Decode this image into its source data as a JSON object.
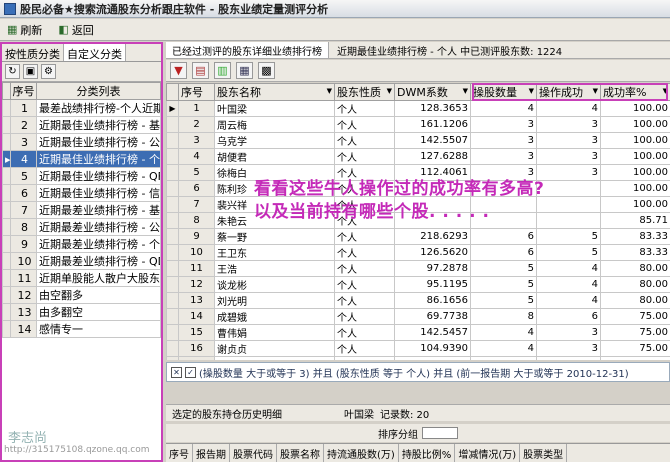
{
  "window": {
    "title": "股民必备★搜索流通股东分析跟庄软件  -  股东业绩定量测评分析"
  },
  "toolbar": {
    "refresh": "刷新",
    "back": "返回"
  },
  "left": {
    "tabs": [
      "按性质分类",
      "自定义分类"
    ],
    "headers": [
      "序号",
      "分类列表"
    ],
    "rows": [
      [
        "1",
        "最差战绩排行榜-个人近期"
      ],
      [
        "2",
        "近期最佳业绩排行榜 - 基金"
      ],
      [
        "3",
        "近期最佳业绩排行榜 - 公司"
      ],
      [
        "4",
        "近期最佳业绩排行榜 - 个人"
      ],
      [
        "5",
        "近期最佳业绩排行榜 - QFII"
      ],
      [
        "6",
        "近期最佳业绩排行榜 - 信"
      ],
      [
        "7",
        "近期最差业绩排行榜 - 基金"
      ],
      [
        "8",
        "近期最差业绩排行榜 - 公司"
      ],
      [
        "9",
        "近期最差业绩排行榜 - 个人"
      ],
      [
        "10",
        "近期最差业绩排行榜 - QDII"
      ],
      [
        "11",
        "近期单股能人散户大股东排"
      ],
      [
        "12",
        "由空翻多"
      ],
      [
        "13",
        "由多翻空"
      ],
      [
        "14",
        "感情专一"
      ]
    ],
    "selected_index": 3
  },
  "right": {
    "tab_title": "已经过测评的股东详细业绩排行榜",
    "info": "近期最佳业绩排行榜 - 个人 中已测评股东数: 1224",
    "headers": [
      "序号",
      "股东名称",
      "股东性质",
      "DWM系数",
      "操股数量",
      "操作成功",
      "成功率%"
    ],
    "rows": [
      [
        "1",
        "叶国梁",
        "个人",
        "128.3653",
        "4",
        "4",
        "100.00"
      ],
      [
        "2",
        "周云梅",
        "个人",
        "161.1206",
        "3",
        "3",
        "100.00"
      ],
      [
        "3",
        "乌克学",
        "个人",
        "142.5507",
        "3",
        "3",
        "100.00"
      ],
      [
        "4",
        "胡便君",
        "个人",
        "127.6288",
        "3",
        "3",
        "100.00"
      ],
      [
        "5",
        "徐梅白",
        "个人",
        "112.4061",
        "3",
        "3",
        "100.00"
      ],
      [
        "6",
        "陈利珍",
        "个人",
        "",
        "",
        "",
        "100.00"
      ],
      [
        "7",
        "裴兴祥",
        "个人",
        "",
        "",
        "",
        "100.00"
      ],
      [
        "8",
        "朱艳云",
        "个人",
        "",
        "",
        "",
        "85.71"
      ],
      [
        "9",
        "蔡一野",
        "个人",
        "218.6293",
        "6",
        "5",
        "83.33"
      ],
      [
        "10",
        "王卫东",
        "个人",
        "126.5620",
        "6",
        "5",
        "83.33"
      ],
      [
        "11",
        "王浩",
        "个人",
        "97.2878",
        "5",
        "4",
        "80.00"
      ],
      [
        "12",
        "谈龙彬",
        "个人",
        "95.1195",
        "5",
        "4",
        "80.00"
      ],
      [
        "13",
        "刘光明",
        "个人",
        "86.1656",
        "5",
        "4",
        "80.00"
      ],
      [
        "14",
        "成碧娥",
        "个人",
        "69.7738",
        "8",
        "6",
        "75.00"
      ],
      [
        "15",
        "曹伟娟",
        "个人",
        "142.5457",
        "4",
        "3",
        "75.00"
      ],
      [
        "16",
        "谢贞贞",
        "个人",
        "104.9390",
        "4",
        "3",
        "75.00"
      ],
      [
        "17",
        "朱福",
        "个人",
        "102.0171",
        "4",
        "3",
        "75.00"
      ],
      [
        "18",
        "李骏",
        "个人",
        "74.7747",
        "4",
        "3",
        "75.00"
      ]
    ],
    "selected_index": 0
  },
  "overlay": {
    "line1": "看看这些牛人操作过的成功率有多高?",
    "line2": "以及当前持有哪些个股.  .  .  .  ."
  },
  "filter": {
    "text": "(操股数量 大于或等于 3) 并且 (股东性质 等于 个人) 并且 (前一报告期 大于或等于 2010-12-31)"
  },
  "bottom": {
    "label": "选定的股东持仓历史明细",
    "name": "叶国梁",
    "records": "记录数: 20",
    "group_label": "排序分组",
    "columns": [
      "序号",
      "报告期",
      "股票代码",
      "股票名称",
      "持流通股数(万)",
      "持股比例%",
      "增减情况(万)",
      "股票类型"
    ]
  },
  "watermark": {
    "name": "李志尚",
    "url": "http://315175108.qzone.qq.com"
  }
}
